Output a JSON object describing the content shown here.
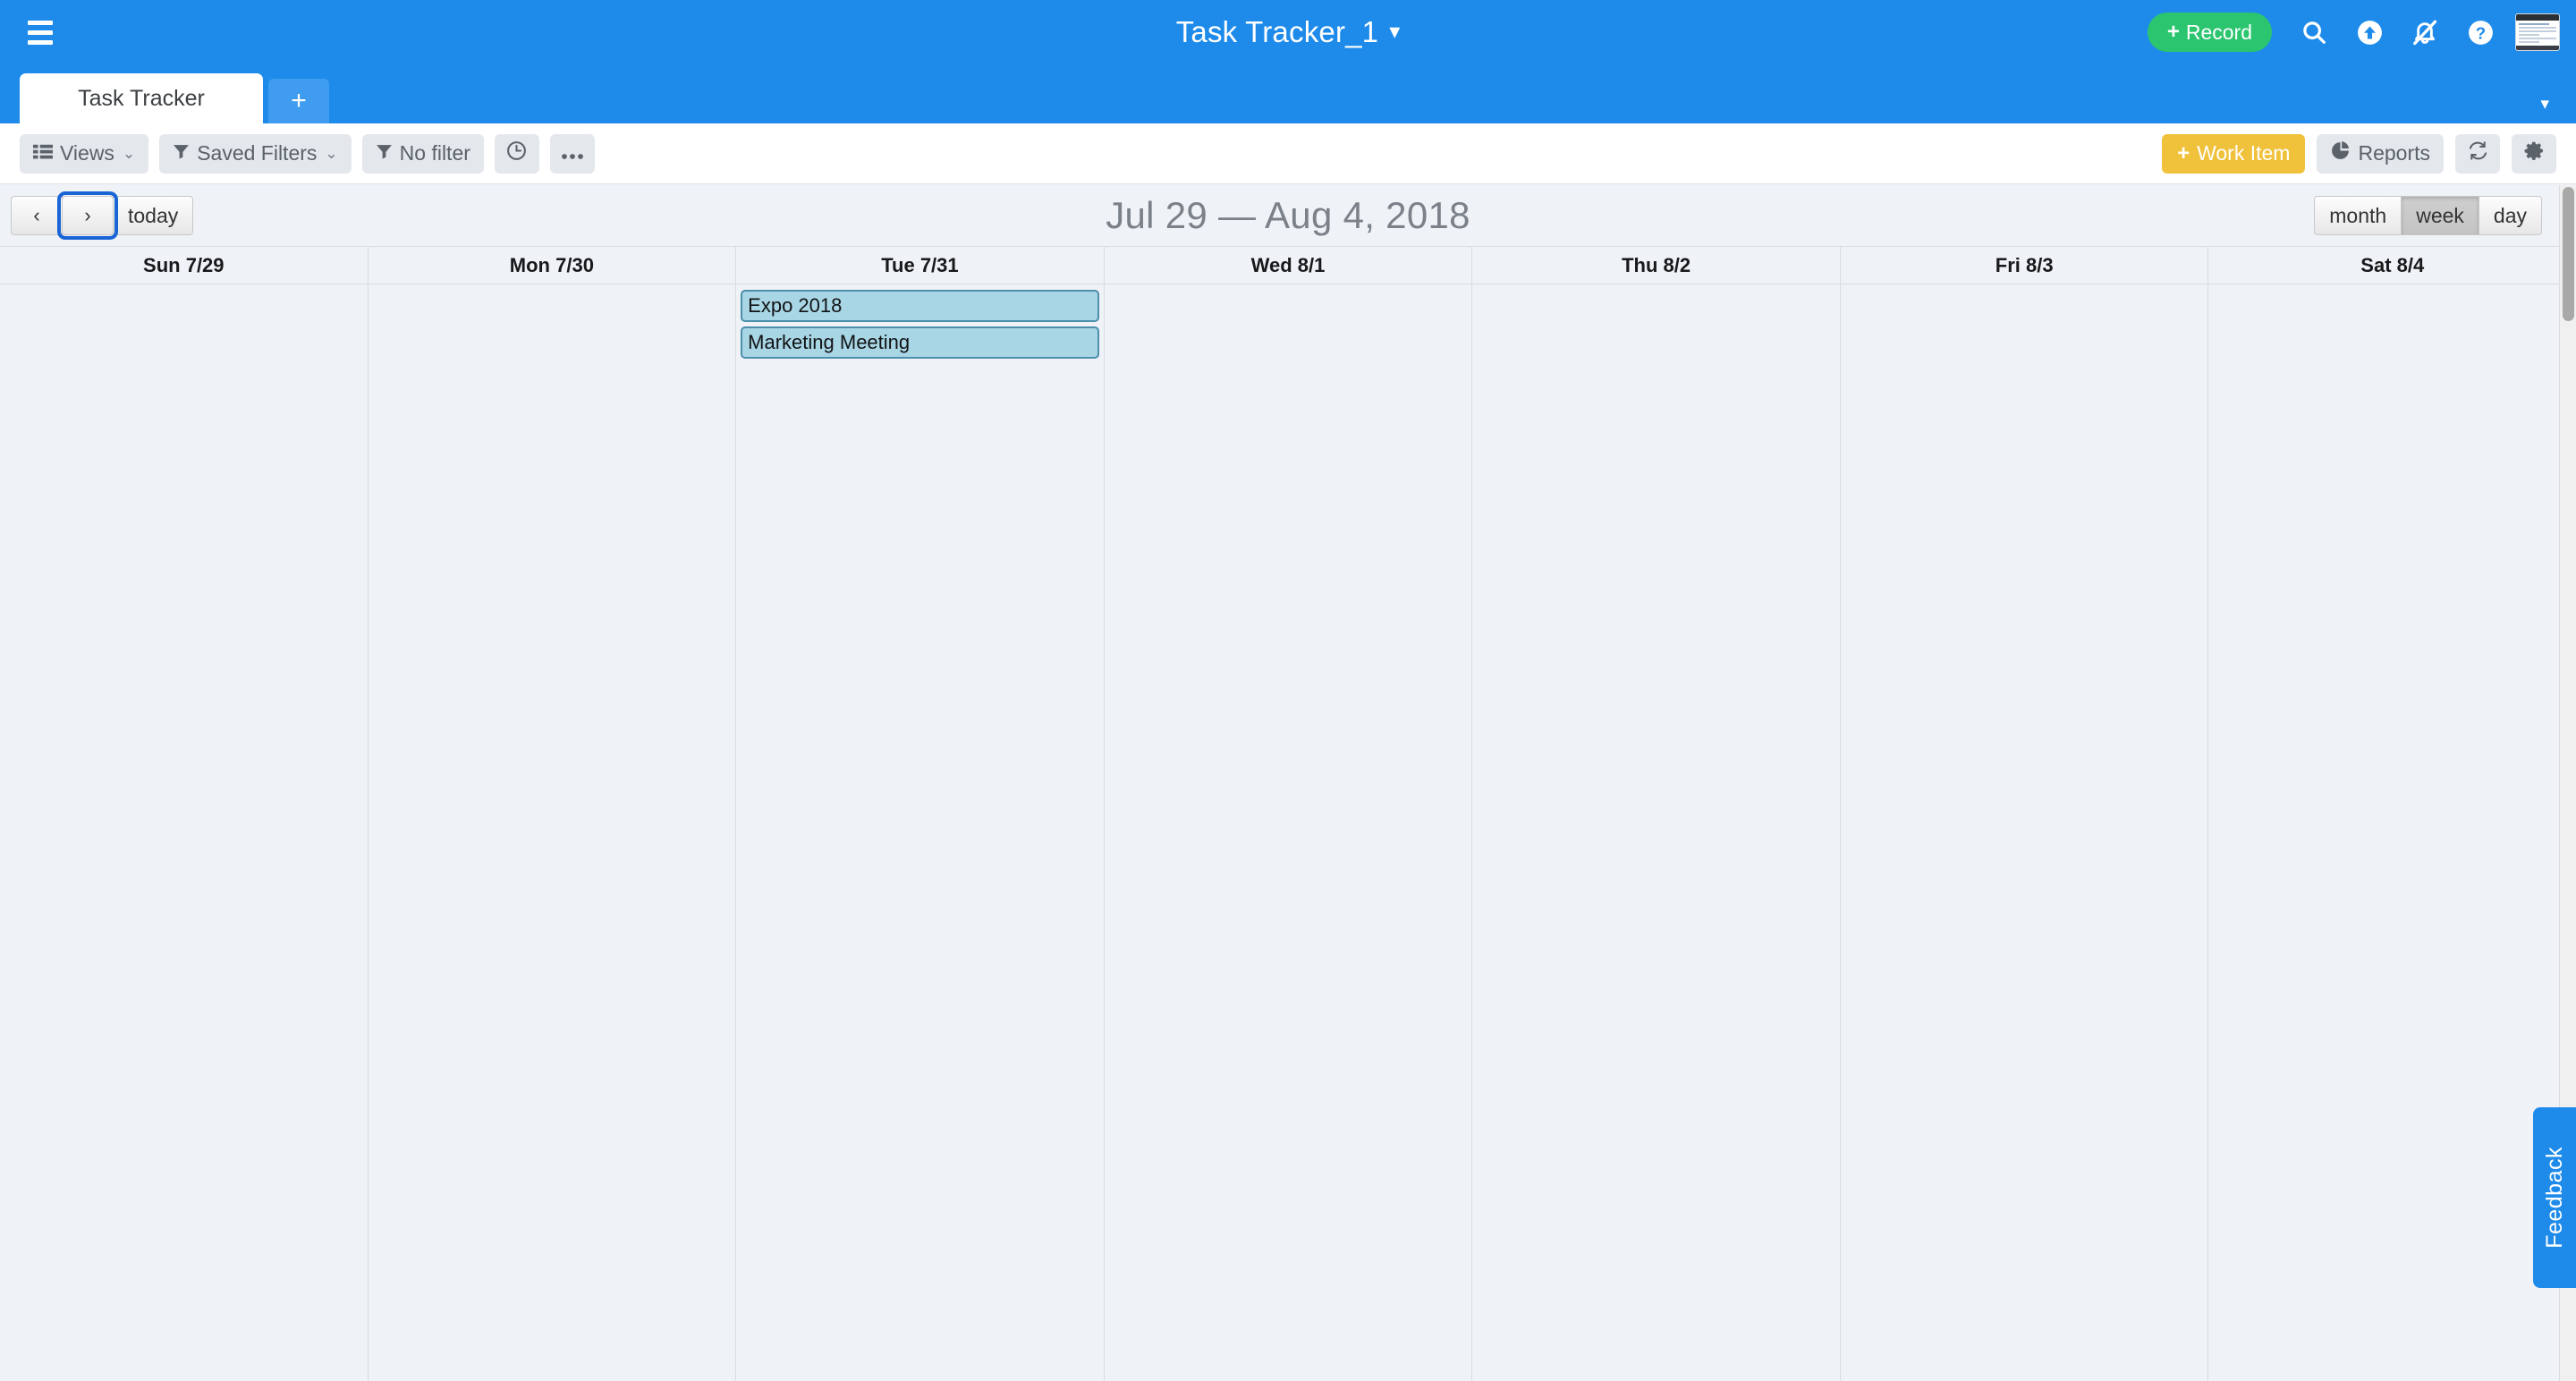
{
  "topbar": {
    "menu_icon": "hamburger-menu-icon",
    "app_title": "Task Tracker_1",
    "title_caret": "▾",
    "record_button": {
      "plus": "+",
      "label": "Record"
    },
    "icons": [
      {
        "name": "search-icon",
        "label": "Search"
      },
      {
        "name": "upload-icon",
        "label": "Upload"
      },
      {
        "name": "bell-off-icon",
        "label": "Notifications muted"
      },
      {
        "name": "help-icon",
        "label": "Help"
      }
    ],
    "thumbnail": {
      "name": "screenshot-thumbnail"
    }
  },
  "tabstrip": {
    "tabs": [
      {
        "label": "Task Tracker",
        "active": true
      }
    ],
    "add_tab": "+",
    "overflow_caret": "▾"
  },
  "toolbar": {
    "left": [
      {
        "name": "views-button",
        "icon": "list-icon",
        "label": "Views",
        "caret": "⌄"
      },
      {
        "name": "saved-filters-button",
        "icon": "funnel-icon",
        "label": "Saved Filters",
        "caret": "⌄"
      },
      {
        "name": "no-filter-button",
        "icon": "funnel-icon",
        "label": "No filter"
      },
      {
        "name": "recent-button",
        "icon": "clock-icon",
        "label": ""
      },
      {
        "name": "more-button",
        "icon": "ellipsis-icon",
        "label": ""
      }
    ],
    "right": {
      "work_item": {
        "plus": "+",
        "label": "Work Item"
      },
      "reports": {
        "icon": "pie-chart-icon",
        "label": "Reports"
      },
      "refresh": {
        "icon": "refresh-icon"
      },
      "settings": {
        "icon": "gear-icon"
      }
    }
  },
  "calendar_nav": {
    "prev_label": "‹",
    "next_label": "›",
    "today_label": "today",
    "title": "Jul 29 — Aug 4, 2018",
    "views": [
      {
        "label": "month",
        "active": false
      },
      {
        "label": "week",
        "active": true
      },
      {
        "label": "day",
        "active": false
      }
    ]
  },
  "calendar": {
    "days": [
      {
        "header": "Sun 7/29",
        "events": []
      },
      {
        "header": "Mon 7/30",
        "events": []
      },
      {
        "header": "Tue 7/31",
        "events": [
          {
            "title": "Expo 2018"
          },
          {
            "title": "Marketing Meeting"
          }
        ]
      },
      {
        "header": "Wed 8/1",
        "events": []
      },
      {
        "header": "Thu 8/2",
        "events": []
      },
      {
        "header": "Fri 8/3",
        "events": []
      },
      {
        "header": "Sat 8/4",
        "events": []
      }
    ]
  },
  "feedback": {
    "label": "Feedback"
  },
  "colors": {
    "brand_blue": "#1e8bea",
    "record_green": "#2bc56f",
    "work_item_yellow": "#f0c13b",
    "event_fill": "#a9d6e5",
    "event_border": "#4b8fad",
    "grid_bg": "#eff2f7"
  }
}
